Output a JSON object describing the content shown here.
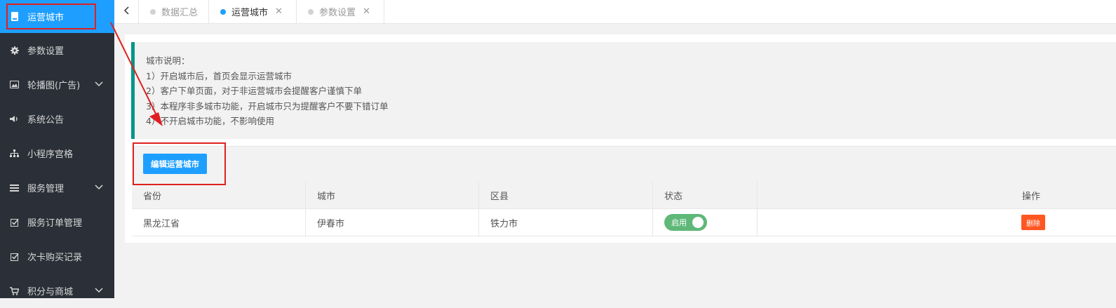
{
  "sidebar": {
    "items": [
      {
        "label": "运营城市",
        "icon": "city-icon",
        "active": true,
        "expandable": false
      },
      {
        "label": "参数设置",
        "icon": "gear-icon",
        "active": false,
        "expandable": false
      },
      {
        "label": "轮播图(广告)",
        "icon": "image-icon",
        "active": false,
        "expandable": true
      },
      {
        "label": "系统公告",
        "icon": "speaker-icon",
        "active": false,
        "expandable": false
      },
      {
        "label": "小程序宫格",
        "icon": "sitemap-icon",
        "active": false,
        "expandable": false
      },
      {
        "label": "服务管理",
        "icon": "list-icon",
        "active": false,
        "expandable": true
      },
      {
        "label": "服务订单管理",
        "icon": "checkbox-icon",
        "active": false,
        "expandable": false
      },
      {
        "label": "次卡购买记录",
        "icon": "checkbox-icon",
        "active": false,
        "expandable": false
      },
      {
        "label": "积分与商城",
        "icon": "cart-icon",
        "active": false,
        "expandable": true
      }
    ]
  },
  "tabs": [
    {
      "label": "数据汇总",
      "active": false,
      "closable": false
    },
    {
      "label": "运营城市",
      "active": true,
      "closable": true
    },
    {
      "label": "参数设置",
      "active": false,
      "closable": true
    }
  ],
  "notice": {
    "title": "城市说明：",
    "lines": [
      "1）开启城市后，首页会显示运营城市",
      "2）客户下单页面，对于非运营城市会提醒客户谨慎下单",
      "3）本程序非多城市功能，开启城市只为提醒客户不要下错订单",
      "4）不开启城市功能，不影响使用"
    ]
  },
  "toolbar": {
    "edit_label": "编辑运营城市"
  },
  "table": {
    "headers": [
      "省份",
      "城市",
      "区县",
      "状态",
      "操作"
    ],
    "rows": [
      {
        "province": "黑龙江省",
        "city": "伊春市",
        "district": "铁力市",
        "status": "启用",
        "delete_label": "删除"
      }
    ]
  },
  "colors": {
    "sidebar_bg": "#2b3038",
    "accent": "#1e9fff",
    "switch_on": "#5fb878",
    "delete": "#ff5722",
    "highlight": "#e02020",
    "notice_border": "#009688"
  }
}
